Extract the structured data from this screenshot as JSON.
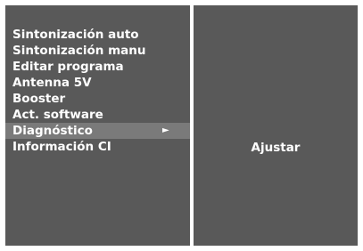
{
  "menu": {
    "items": [
      {
        "label": "Sintonización auto"
      },
      {
        "label": "Sintonización manu"
      },
      {
        "label": "Editar programa"
      },
      {
        "label": "Antenna 5V"
      },
      {
        "label": "Booster"
      },
      {
        "label": "Act. software"
      },
      {
        "label": "Diagnóstico",
        "arrow": "►",
        "selected": true
      },
      {
        "label": "Información CI"
      }
    ]
  },
  "submenu": {
    "label": "Ajustar"
  },
  "colors": {
    "panel": "#595959",
    "highlight": "#7a7a7a",
    "text": "#ffffff",
    "border": "#ffffff"
  }
}
